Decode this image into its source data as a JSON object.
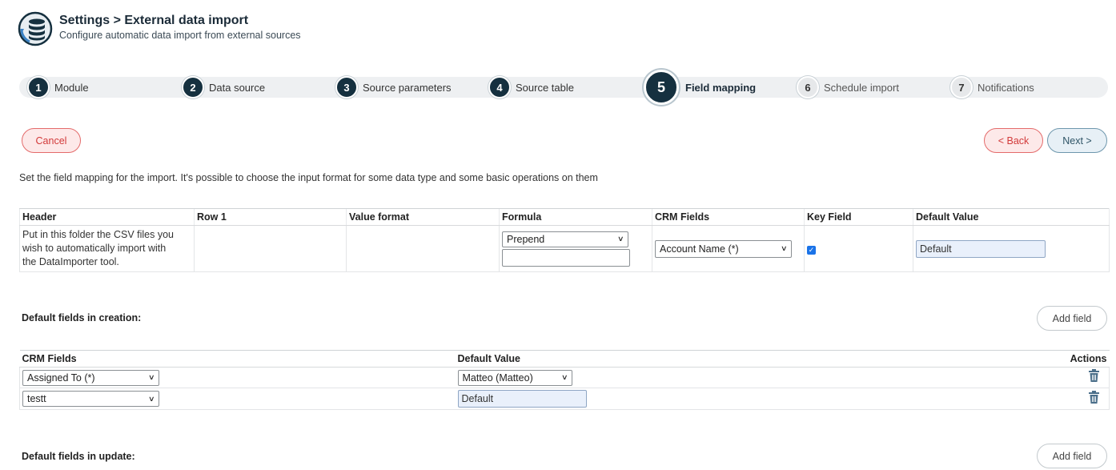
{
  "header": {
    "title": "Settings > External data import",
    "subtitle": "Configure automatic data import from external sources",
    "icon": "database-sync-icon"
  },
  "steps": [
    {
      "num": "1",
      "label": "Module",
      "state": "done"
    },
    {
      "num": "2",
      "label": "Data source",
      "state": "done"
    },
    {
      "num": "3",
      "label": "Source parameters",
      "state": "done"
    },
    {
      "num": "4",
      "label": "Source table",
      "state": "done"
    },
    {
      "num": "5",
      "label": "Field mapping",
      "state": "active"
    },
    {
      "num": "6",
      "label": "Schedule import",
      "state": "future"
    },
    {
      "num": "7",
      "label": "Notifications",
      "state": "future"
    }
  ],
  "buttons": {
    "cancel": "Cancel",
    "back": "< Back",
    "next": "Next >",
    "add_field": "Add field"
  },
  "instruction": "Set the field mapping for the import. It's possible to choose the input format for some data type and some basic operations on them",
  "mapping": {
    "columns": [
      "Header",
      "Row 1",
      "Value format",
      "Formula",
      "CRM Fields",
      "Key Field",
      "Default Value"
    ],
    "row": {
      "header": "Put in this folder the CSV files you wish to automatically import with the DataImporter tool.",
      "row1": "",
      "value_format": "",
      "formula_select": "Prepend",
      "formula_text": "",
      "crm_field": "Account Name (*)",
      "key_field": true,
      "default_value": "Default"
    }
  },
  "creation": {
    "title": "Default fields in creation:",
    "columns": [
      "CRM Fields",
      "Default Value",
      "Actions"
    ],
    "rows": [
      {
        "field": "Assigned To (*)",
        "value": "Matteo (Matteo)",
        "value_type": "select"
      },
      {
        "field": "testt",
        "value": "Default",
        "value_type": "text"
      }
    ]
  },
  "update": {
    "title": "Default fields in update:"
  },
  "colors": {
    "primary_dark": "#15303f",
    "cancel_red": "#d23a3a",
    "next_blue": "#2e5466",
    "trash": "#4b6f8a"
  }
}
